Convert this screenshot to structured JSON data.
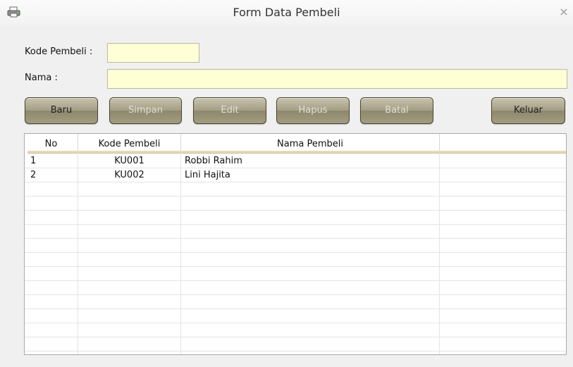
{
  "window": {
    "title": "Form Data Pembeli",
    "close_label": "×",
    "icon": "printer-icon"
  },
  "form": {
    "kode_label": "Kode Pembeli :",
    "kode_value": "",
    "nama_label": "Nama :",
    "nama_value": ""
  },
  "buttons": {
    "baru": "Baru",
    "simpan": "Simpan",
    "edit": "Edit",
    "hapus": "Hapus",
    "batal": "Batal",
    "keluar": "Keluar"
  },
  "table": {
    "headers": [
      "No",
      "Kode Pembeli",
      "Nama Pembeli",
      ""
    ],
    "rows": [
      {
        "no": "1",
        "kode": "KU001",
        "nama": "Robbi Rahim"
      },
      {
        "no": "2",
        "kode": "KU002",
        "nama": "Lini Hajita"
      }
    ]
  },
  "colors": {
    "field_bg": "#ffffd6",
    "button": "#a39d83",
    "header_line": "#e8d9b8"
  }
}
